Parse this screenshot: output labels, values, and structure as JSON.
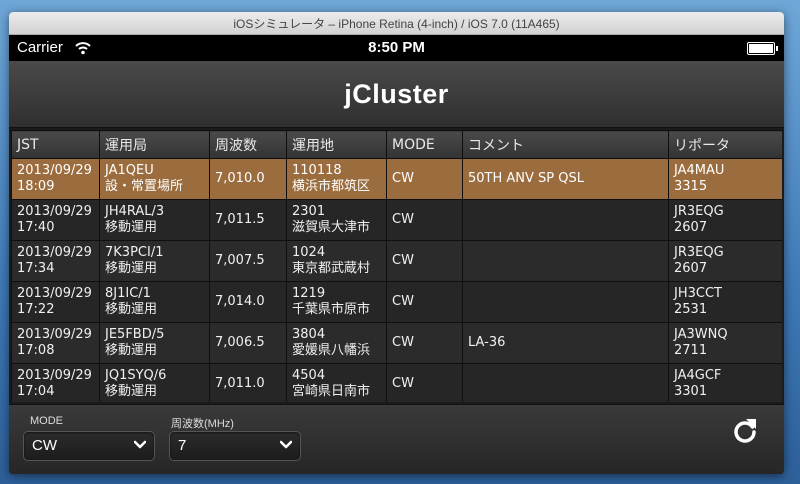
{
  "window": {
    "title": "iOSシミュレータ – iPhone Retina (4-inch) / iOS 7.0 (11A465)"
  },
  "status_bar": {
    "carrier": "Carrier",
    "time": "8:50 PM"
  },
  "nav": {
    "title": "jCluster"
  },
  "table": {
    "headers": [
      "JST",
      "運用局",
      "周波数",
      "運用地",
      "MODE",
      "コメント",
      "リポータ"
    ],
    "rows": [
      {
        "date": "2013/09/29",
        "time": "18:09",
        "station": "JA1QEU",
        "station_note": "設・常置場所",
        "freq": "7,010.0",
        "loc_code": "110118",
        "loc_name": "横浜市都筑区",
        "mode": "CW",
        "comment": "50TH ANV SP QSL",
        "reporter": "JA4MAU",
        "reporter_code": "3315"
      },
      {
        "date": "2013/09/29",
        "time": "17:40",
        "station": "JH4RAL/3",
        "station_note": "移動運用",
        "freq": "7,011.5",
        "loc_code": "2301",
        "loc_name": "滋賀県大津市",
        "mode": "CW",
        "comment": "",
        "reporter": "JR3EQG",
        "reporter_code": "2607"
      },
      {
        "date": "2013/09/29",
        "time": "17:34",
        "station": "7K3PCI/1",
        "station_note": "移動運用",
        "freq": "7,007.5",
        "loc_code": "1024",
        "loc_name": "東京都武蔵村",
        "mode": "CW",
        "comment": "",
        "reporter": "JR3EQG",
        "reporter_code": "2607"
      },
      {
        "date": "2013/09/29",
        "time": "17:22",
        "station": "8J1IC/1",
        "station_note": "移動運用",
        "freq": "7,014.0",
        "loc_code": "1219",
        "loc_name": "千葉県市原市",
        "mode": "CW",
        "comment": "",
        "reporter": "JH3CCT",
        "reporter_code": "2531"
      },
      {
        "date": "2013/09/29",
        "time": "17:08",
        "station": "JE5FBD/5",
        "station_note": "移動運用",
        "freq": "7,006.5",
        "loc_code": "3804",
        "loc_name": "愛媛県八幡浜",
        "mode": "CW",
        "comment": "LA-36",
        "reporter": "JA3WNQ",
        "reporter_code": "2711"
      },
      {
        "date": "2013/09/29",
        "time": "17:04",
        "station": "JQ1SYQ/6",
        "station_note": "移動運用",
        "freq": "7,011.0",
        "loc_code": "4504",
        "loc_name": "宮崎県日南市",
        "mode": "CW",
        "comment": "",
        "reporter": "JA4GCF",
        "reporter_code": "3301"
      }
    ]
  },
  "toolbar": {
    "mode_label": "MODE",
    "mode_value": "CW",
    "freq_label": "周波数(MHz)",
    "freq_value": "7"
  },
  "colors": {
    "selected_row": "#9b6c3d",
    "header": "#3b3b3b"
  },
  "icons": {
    "refresh": "refresh-icon",
    "wifi": "wifi-icon",
    "chevron": "chevron-down-icon"
  }
}
